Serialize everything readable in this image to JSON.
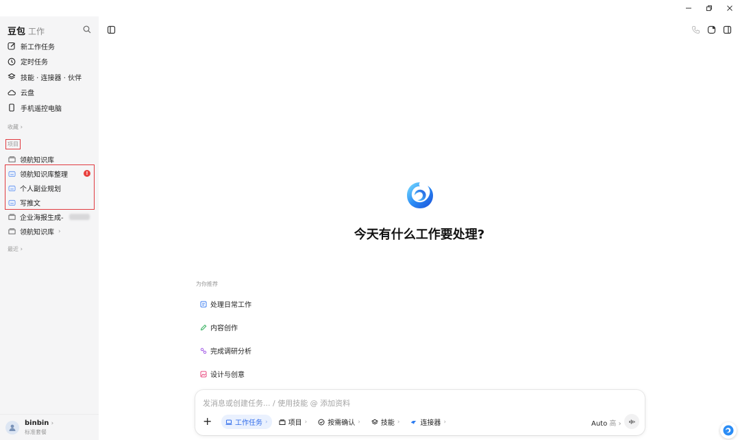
{
  "window": {
    "controls": [
      "minimize-icon",
      "restore-icon",
      "close-icon"
    ]
  },
  "sidebar": {
    "brand_name": "豆包",
    "brand_sub": "工作",
    "nav": [
      {
        "label": "新工作任务",
        "icon": "edit-icon"
      },
      {
        "label": "定时任务",
        "icon": "clock-icon"
      },
      {
        "label": "技能 · 连接器 · 伙伴",
        "icon": "layers-icon"
      },
      {
        "label": "云盘",
        "icon": "cloud-icon"
      },
      {
        "label": "手机遥控电脑",
        "icon": "phone-icon"
      }
    ],
    "collection_label": "收藏",
    "projects_label": "项目",
    "projects": [
      {
        "label": "领航知识库",
        "icon": "folder-icon"
      },
      {
        "label": "领航知识库整理",
        "icon": "project-icon",
        "badge": "!"
      },
      {
        "label": "个人副业规划",
        "icon": "project-icon"
      },
      {
        "label": "写推文",
        "icon": "project-icon"
      },
      {
        "label": "企业海报生成-",
        "icon": "folder-icon"
      },
      {
        "label": "领航知识库",
        "icon": "folder-icon",
        "chevron": "›"
      }
    ],
    "recent_label": "最近",
    "user": {
      "name": "binbin",
      "chevron": "›",
      "plan": "标准套餐"
    }
  },
  "main": {
    "headline": "今天有什么工作要处理?",
    "recommend_label": "为你推荐",
    "recommendations": [
      {
        "label": "处理日常工作",
        "icon": "doc-icon",
        "color": "#3b7cf0"
      },
      {
        "label": "内容创作",
        "icon": "pen-icon",
        "color": "#2fae5a"
      },
      {
        "label": "完成调研分析",
        "icon": "research-icon",
        "color": "#a35be6"
      },
      {
        "label": "设计与创意",
        "icon": "image-icon",
        "color": "#e8467c"
      }
    ]
  },
  "composer": {
    "placeholder": "发消息或创建任务... / 使用技能 @ 添加资料",
    "plus": "+",
    "chips": [
      {
        "label": "工作任务",
        "icon": "laptop-icon",
        "active": true
      },
      {
        "label": "项目",
        "icon": "folder-icon"
      },
      {
        "label": "按需确认",
        "icon": "check-circle-icon"
      },
      {
        "label": "技能",
        "icon": "layers-icon"
      },
      {
        "label": "连接器",
        "icon": "connector-icon"
      }
    ],
    "auto_label": "Auto",
    "auto_level": "高",
    "auto_chev": "›"
  },
  "colors": {
    "accent": "#2f6bea",
    "highlight_box": "#e0393e",
    "sidebar_bg": "#f5f5f6"
  }
}
